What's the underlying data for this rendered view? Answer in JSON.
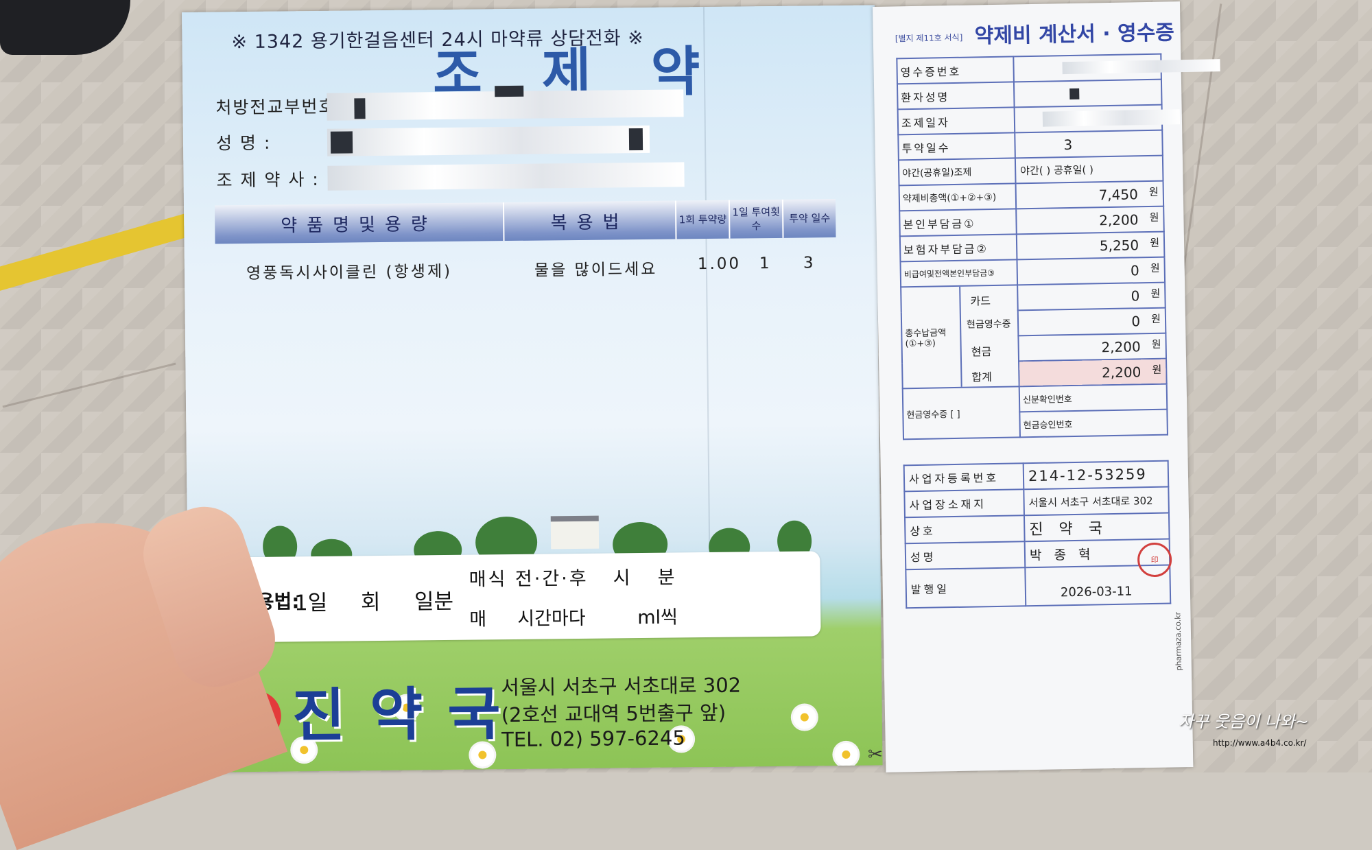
{
  "pamphlet": {
    "hotline": "※ 1342 용기한걸음센터 24시 마약류 상담전화 ※",
    "title": "조 제 약",
    "labels": {
      "rx_number": "처방전교부번호 :",
      "name": "성      명 :",
      "pharmacist": "조 제 약 사 :"
    },
    "table": {
      "headers": {
        "drug": "약품명및용량",
        "method": "복용법",
        "dose": "1회 투약량",
        "times": "1일 투여횟수",
        "days": "투약 일수"
      },
      "rows": [
        {
          "drug": "영풍독시사이클린 (항생제)",
          "method": "물을 많이드세요",
          "dose": "1.00",
          "times": "1",
          "days": "3"
        }
      ]
    },
    "usage": {
      "label": "복용법:",
      "day": "1일",
      "times": "회",
      "portion": "일분",
      "meal": "매식 전·간·후",
      "hour": "시",
      "minute": "분",
      "every": "매",
      "interval": "시간마다",
      "ml": "ml씩"
    },
    "brand": "진약국",
    "address1": "서울시 서초구 서초대로 302",
    "address2": "(2호선 교대역 5번출구 앞)",
    "tel": "TEL. 02) 597-6245"
  },
  "receipt": {
    "form_no": "[별지 제11호 서식]",
    "title": "약제비 계산서 · 영수증",
    "rows": [
      {
        "label": "영수증번호",
        "value": ""
      },
      {
        "label": "환자성명",
        "value": ""
      },
      {
        "label": "조제일자",
        "value": ""
      },
      {
        "label": "투약일수",
        "value": "3"
      },
      {
        "label": "야간(공휴일)조제",
        "value": "야간(   ) 공휴일(   )"
      },
      {
        "label": "약제비총액(①+②+③)",
        "value": "7,450",
        "unit": "원"
      },
      {
        "label": "본인부담금①",
        "value": "2,200",
        "unit": "원"
      },
      {
        "label": "보험자부담금②",
        "value": "5,250",
        "unit": "원"
      },
      {
        "label": "비급여및전액본인부담금③",
        "value": "0",
        "unit": "원"
      },
      {
        "label": "카드",
        "value": "0",
        "unit": "원"
      },
      {
        "label": "현금영수증",
        "value": "0",
        "unit": "원"
      },
      {
        "label": "현금",
        "value": "2,200",
        "unit": "원"
      },
      {
        "label": "합계",
        "value": "2,200",
        "unit": "원"
      },
      {
        "label": "신분확인번호",
        "value": ""
      },
      {
        "label": "현금승인번호",
        "value": ""
      }
    ],
    "total_group_label": "총수납금액 (①+③)",
    "cash_receipt_group": "현금영수증 [    ]",
    "business": [
      {
        "label": "사업자등록번호",
        "value": "214-12-53259"
      },
      {
        "label": "사업장소재지",
        "value": "서울시 서초구 서초대로 302"
      },
      {
        "label": "상호",
        "value": "진 약 국"
      },
      {
        "label": "성명",
        "value": "박 종 혁"
      },
      {
        "label": "발행일",
        "value": "2026-03-11"
      }
    ],
    "side_url": "pharmaza.co.kr"
  },
  "watermark": {
    "text": "자꾸 웃음이 나와~",
    "url": "http://www.a4b4.co.kr/"
  }
}
